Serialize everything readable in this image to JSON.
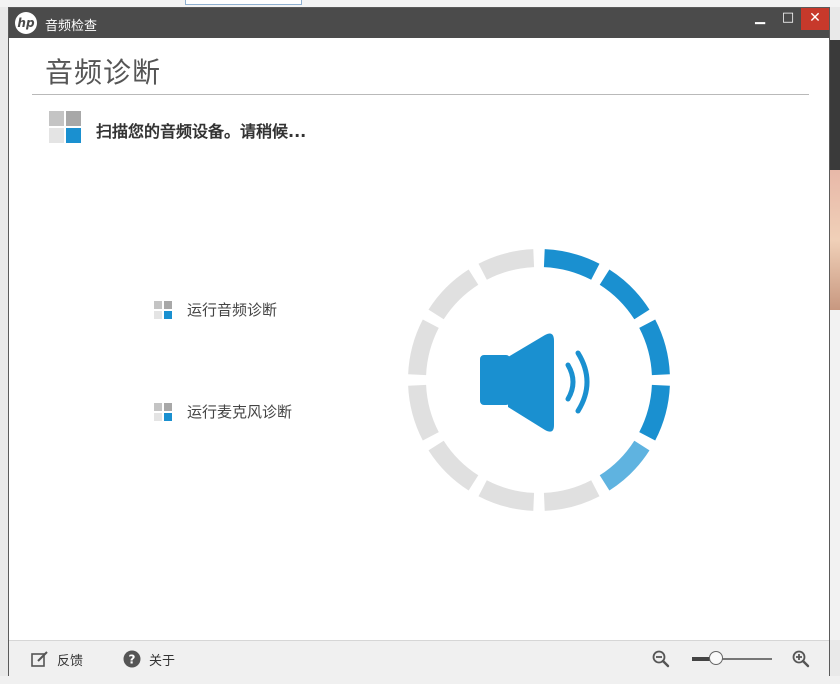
{
  "window": {
    "title": "音频检查",
    "logo_text": "hp",
    "controls": {
      "minimize": "▁",
      "maximize": "□",
      "close": "✕"
    }
  },
  "page": {
    "title": "音频诊断",
    "status": "扫描您的音频设备。请稍候..."
  },
  "diagnostics": [
    {
      "label": "运行音频诊断"
    },
    {
      "label": "运行麦克风诊断"
    }
  ],
  "scan_indicator": {
    "segments_total": 12,
    "segments_active": 5,
    "active_color": "#1a90d0",
    "light_active_color": "#5fb3e0",
    "inactive_color": "#e0e0e0",
    "icon": "speaker-icon"
  },
  "footer": {
    "feedback_label": "反馈",
    "about_label": "关于",
    "zoom_level": 0.3
  },
  "colors": {
    "titlebar": "#4b4b4b",
    "accent": "#1a90d0",
    "close": "#c7392b"
  }
}
